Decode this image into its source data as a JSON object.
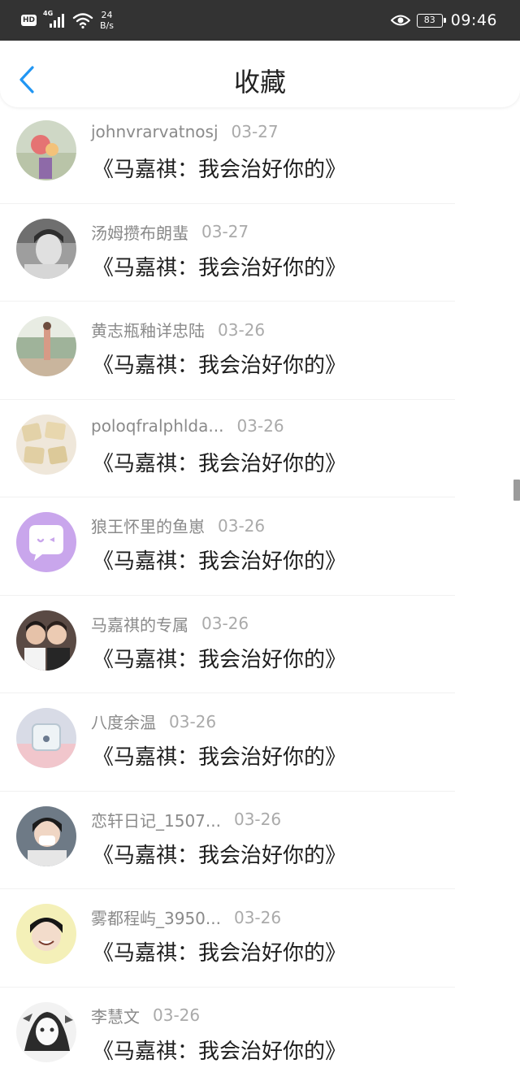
{
  "status_bar": {
    "hd": "HD",
    "network": "4G",
    "speed_value": "24",
    "speed_unit": "B/s",
    "battery": "83",
    "time": "09:46"
  },
  "header": {
    "title": "收藏",
    "back_icon": "chevron-left-icon"
  },
  "items": [
    {
      "name": "johnvrarvatnosj",
      "date": "03-27",
      "title": "《马嘉祺：我会治好你的》"
    },
    {
      "name": "汤姆攒布朗蜚",
      "date": "03-27",
      "title": "《马嘉祺：我会治好你的》"
    },
    {
      "name": "黄志瓶釉详忠陆",
      "date": "03-26",
      "title": "《马嘉祺：我会治好你的》"
    },
    {
      "name": "poloqfralphlda...",
      "date": "03-26",
      "title": "《马嘉祺：我会治好你的》"
    },
    {
      "name": "狼王怀里的鱼崽",
      "date": "03-26",
      "title": "《马嘉祺：我会治好你的》"
    },
    {
      "name": "马嘉祺的专属",
      "date": "03-26",
      "title": "《马嘉祺：我会治好你的》"
    },
    {
      "name": "八度余温",
      "date": "03-26",
      "title": "《马嘉祺：我会治好你的》"
    },
    {
      "name": "恋轩日记_1507...",
      "date": "03-26",
      "title": "《马嘉祺：我会治好你的》"
    },
    {
      "name": "雾都程屿_3950...",
      "date": "03-26",
      "title": "《马嘉祺：我会治好你的》"
    },
    {
      "name": "李慧文",
      "date": "03-26",
      "title": "《马嘉祺：我会治好你的》"
    }
  ],
  "colors": {
    "status_bar_bg": "#333333",
    "accent_blue": "#2196f3",
    "name_gray": "#8a8a8a",
    "date_gray": "#aaaaaa",
    "title_text": "#1e1e1e"
  }
}
